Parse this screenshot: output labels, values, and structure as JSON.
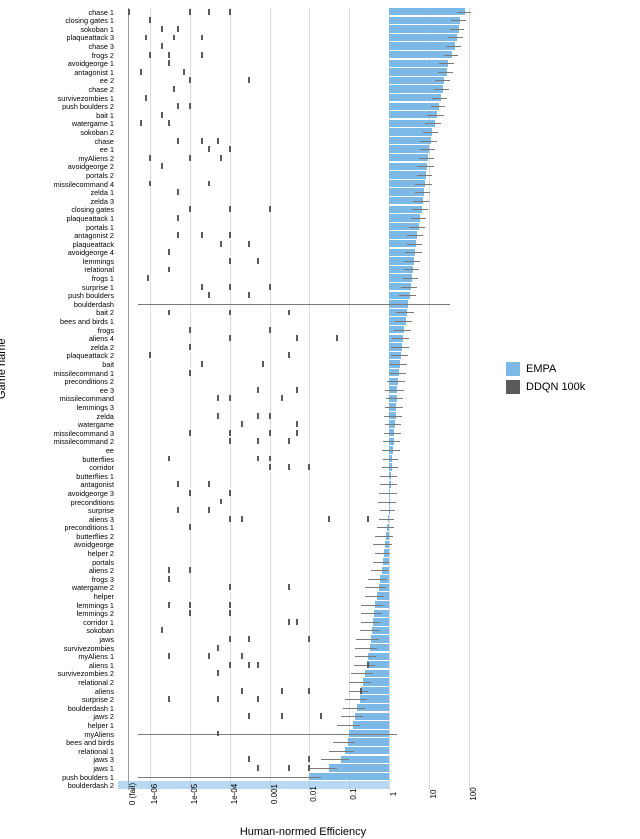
{
  "chart_data": {
    "type": "bar",
    "xlabel": "Human-normed Efficiency",
    "ylabel": "Game name",
    "xscale": "symlog_with_zero",
    "xticks": [
      {
        "v": 0,
        "label": "0 (fail)"
      },
      {
        "v": 1e-06,
        "label": "1e-06"
      },
      {
        "v": 1e-05,
        "label": "1e-05"
      },
      {
        "v": 0.0001,
        "label": "1e-04"
      },
      {
        "v": 0.001,
        "label": "0.001"
      },
      {
        "v": 0.01,
        "label": "0.01"
      },
      {
        "v": 0.1,
        "label": "0.1"
      },
      {
        "v": 1,
        "label": "1"
      },
      {
        "v": 10,
        "label": "10"
      },
      {
        "v": 100,
        "label": "100"
      }
    ],
    "legend": [
      {
        "name": "EMPA",
        "color": "#7db9e6"
      },
      {
        "name": "DDQN 100k",
        "color": "#5a5a5a"
      }
    ],
    "categories": [
      "chase 1",
      "closing gates 1",
      "sokoban 1",
      "plaqueattack 3",
      "chase 3",
      "frogs 2",
      "avoidgeorge 1",
      "antagonist 1",
      "ee 2",
      "chase 2",
      "survivezombies 1",
      "push boulders 2",
      "bait 1",
      "watergame 1",
      "sokoban 2",
      "chase",
      "ee 1",
      "myAliens 2",
      "avoidgeorge 2",
      "portals 2",
      "missilecommand 4",
      "zelda 1",
      "zelda 3",
      "closing gates",
      "plaqueattack 1",
      "portals 1",
      "antagonist 2",
      "plaqueattack",
      "avoidgeorge 4",
      "lemmings",
      "relational",
      "frogs 1",
      "surprise 1",
      "push boulders",
      "boulderdash",
      "bait 2",
      "bees and birds 1",
      "frogs",
      "aliens 4",
      "zelda 2",
      "plaqueattack 2",
      "bait",
      "missilecommand 1",
      "preconditions 2",
      "ee 3",
      "missilecommand",
      "lemmings 3",
      "zelda",
      "watergame",
      "missilecommand 3",
      "missilecommand 2",
      "ee",
      "butterflies",
      "corridor",
      "butterflies 1",
      "antagonist",
      "avoidgeorge 3",
      "preconditions",
      "surprise",
      "aliens 3",
      "preconditions 1",
      "butterflies 2",
      "avoidgeorge",
      "helper 2",
      "portals",
      "aliens 2",
      "frogs 3",
      "watergame 2",
      "helper",
      "lemmings 1",
      "lemmings 2",
      "corridor 1",
      "sokoban",
      "jaws",
      "survivezombies",
      "myAliens 1",
      "aliens 1",
      "survivezombies 2",
      "relational 2",
      "aliens",
      "surprise 2",
      "boulderdash 1",
      "jaws 2",
      "helper 1",
      "myAliens",
      "bees and birds",
      "relational 1",
      "jaws 3",
      "jaws 1",
      "push boulders 1",
      "boulderdash 2"
    ],
    "series": [
      {
        "name": "EMPA",
        "kind": "bar",
        "color": "#7db9e6",
        "values": [
          80,
          60,
          55,
          50,
          45,
          38,
          30,
          28,
          24,
          22,
          20,
          18,
          16,
          14,
          12,
          11,
          10,
          9.5,
          9,
          8.5,
          8,
          7.5,
          7,
          6.5,
          6,
          5.5,
          5,
          4.8,
          4.5,
          4.2,
          4,
          3.8,
          3.5,
          3.3,
          3,
          2.8,
          2.6,
          2.4,
          2.2,
          2.1,
          2,
          1.9,
          1.8,
          1.7,
          1.6,
          1.55,
          1.5,
          1.45,
          1.4,
          1.35,
          1.3,
          1.25,
          1.2,
          1.15,
          1.1,
          1.08,
          1.05,
          1.02,
          1.0,
          0.95,
          0.9,
          0.85,
          0.8,
          0.75,
          0.7,
          0.65,
          0.6,
          0.55,
          0.5,
          0.45,
          0.42,
          0.4,
          0.38,
          0.35,
          0.32,
          0.3,
          0.28,
          0.25,
          0.22,
          0.2,
          0.18,
          0.16,
          0.14,
          0.12,
          0.1,
          0.09,
          0.08,
          0.06,
          0.03,
          0.01,
          0
        ],
        "err": [
          30,
          25,
          22,
          20,
          18,
          15,
          12,
          11,
          10,
          9,
          8,
          7,
          7,
          6,
          5,
          5,
          4,
          4,
          4,
          3.5,
          3.5,
          3,
          3,
          2.8,
          2.5,
          2.4,
          2.2,
          2,
          2,
          1.8,
          1.7,
          1.6,
          1.5,
          1.5,
          30,
          1.3,
          1.2,
          1.1,
          1.0,
          1.0,
          0.9,
          0.9,
          0.8,
          0.8,
          0.8,
          0.7,
          0.7,
          0.7,
          0.6,
          0.6,
          0.6,
          0.6,
          0.5,
          0.5,
          0.5,
          0.5,
          0.5,
          0.5,
          0.4,
          0.4,
          0.4,
          0.4,
          0.4,
          0.3,
          0.3,
          0.3,
          0.3,
          0.3,
          0.25,
          0.25,
          0.22,
          0.2,
          0.2,
          0.2,
          0.18,
          0.16,
          0.15,
          0.14,
          0.12,
          0.1,
          0.1,
          0.09,
          0.08,
          0.07,
          1.5,
          0.05,
          0.05,
          0.04,
          0.02,
          0.01,
          0
        ]
      },
      {
        "name": "DDQN 100k",
        "kind": "point",
        "color": "#5a5a5a",
        "values": [
          [
            3e-07,
            1e-05,
            3e-05,
            0.0001
          ],
          [
            1e-06
          ],
          [
            2e-06,
            5e-06
          ],
          [
            8e-07,
            4e-06,
            2e-05
          ],
          [
            2e-06
          ],
          [
            1e-06,
            3e-06,
            2e-05
          ],
          [
            3e-06
          ],
          [
            6e-07,
            7e-06
          ],
          [
            1e-05,
            0.0003
          ],
          [
            4e-06
          ],
          [
            8e-07
          ],
          [
            5e-06,
            1e-05
          ],
          [
            2e-06
          ],
          [
            6e-07,
            3e-06
          ],
          [],
          [
            5e-06,
            2e-05,
            5e-05
          ],
          [
            3e-05,
            0.0001
          ],
          [
            1e-06,
            1e-05,
            6e-05
          ],
          [
            2e-06
          ],
          [],
          [
            1e-06,
            3e-05
          ],
          [
            5e-06
          ],
          [],
          [
            1e-05,
            0.0001,
            0.001
          ],
          [
            5e-06
          ],
          [],
          [
            5e-06,
            2e-05,
            0.0001
          ],
          [
            6e-05,
            0.0003
          ],
          [
            3e-06
          ],
          [
            0.0001,
            0.0005
          ],
          [
            3e-06
          ],
          [
            9e-07
          ],
          [
            2e-05,
            0.0001,
            0.001
          ],
          [
            3e-05,
            0.0003
          ],
          [],
          [
            3e-06,
            0.0001,
            0.003
          ],
          [],
          [
            1e-05,
            0.001
          ],
          [
            0.0001,
            0.005,
            0.05
          ],
          [
            1e-05
          ],
          [
            1e-06,
            0.003
          ],
          [
            2e-05,
            0.0007
          ],
          [
            1e-05
          ],
          [],
          [
            0.0005,
            0.005
          ],
          [
            5e-05,
            0.0001,
            0.002
          ],
          [],
          [
            5e-05,
            0.0005,
            0.001
          ],
          [
            0.0002,
            0.005
          ],
          [
            1e-05,
            0.0001,
            0.001,
            0.005
          ],
          [
            0.0001,
            0.0005,
            0.003
          ],
          [],
          [
            3e-06,
            0.0005,
            0.001
          ],
          [
            0.001,
            0.003,
            0.01
          ],
          [],
          [
            5e-06,
            3e-05
          ],
          [
            1e-05,
            0.0001
          ],
          [
            6e-05
          ],
          [
            5e-06,
            3e-05
          ],
          [
            0.0001,
            0.0002,
            0.03,
            0.3
          ],
          [
            1e-05
          ],
          [],
          [],
          [],
          [],
          [
            3e-06,
            1e-05
          ],
          [
            3e-06
          ],
          [
            0.0001,
            0.003
          ],
          [],
          [
            3e-06,
            1e-05,
            0.0001
          ],
          [
            1e-05,
            0.0001
          ],
          [
            0.003,
            0.005
          ],
          [
            2e-06
          ],
          [
            0.0001,
            0.0003,
            0.01
          ],
          [
            5e-05
          ],
          [
            3e-06,
            3e-05,
            0.0002
          ],
          [
            0.0001,
            0.0003,
            0.0005,
            0.3
          ],
          [
            5e-05
          ],
          [],
          [
            0.0002,
            0.002,
            0.01,
            0.2
          ],
          [
            3e-06,
            5e-05,
            0.0005
          ],
          [],
          [
            0.0003,
            0.002,
            0.02
          ],
          [],
          [
            5e-05
          ],
          [],
          [],
          [
            0.0003,
            0.01
          ],
          [
            0.0005,
            0.003,
            0.01
          ],
          [],
          []
        ]
      }
    ]
  }
}
